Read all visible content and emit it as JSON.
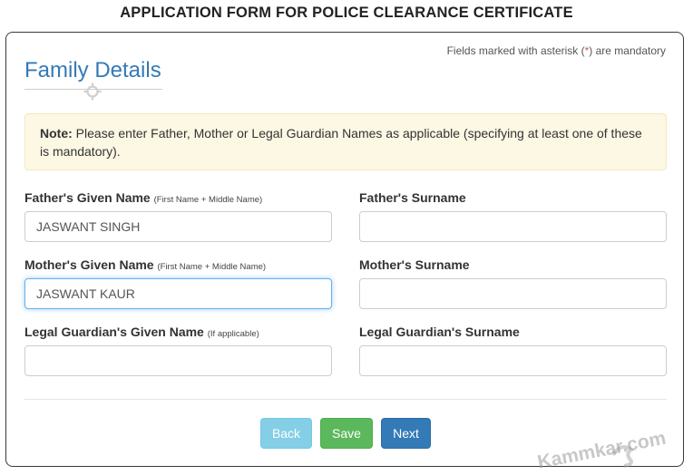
{
  "page": {
    "title": "APPLICATION FORM FOR POLICE CLEARANCE CERTIFICATE"
  },
  "form": {
    "mandatory_prefix": "Fields marked with asterisk (",
    "mandatory_asterisk": "*",
    "mandatory_suffix": ") are mandatory",
    "section_title": "Family Details",
    "note_label": "Note:",
    "note_text": " Please enter Father, Mother or Legal Guardian Names as applicable (specifying at least one of these is mandatory).",
    "fields": {
      "father_given": {
        "label": "Father's Given Name",
        "hint": "(First Name + Middle Name)",
        "value": "JASWANT SINGH"
      },
      "father_surname": {
        "label": "Father's Surname",
        "value": ""
      },
      "mother_given": {
        "label": "Mother's Given Name",
        "hint": "(First Name + Middle Name)",
        "value": "JASWANT KAUR"
      },
      "mother_surname": {
        "label": "Mother's Surname",
        "value": ""
      },
      "guardian_given": {
        "label": "Legal Guardian's Given Name",
        "hint": "(If applicable)",
        "value": ""
      },
      "guardian_surname": {
        "label": "Legal Guardian's Surname",
        "value": ""
      }
    },
    "buttons": {
      "back": "Back",
      "save": "Save",
      "next": "Next"
    }
  },
  "watermark": {
    "text": "Kammkar.com"
  },
  "colors": {
    "accent": "#337ab7",
    "note_bg": "#fcf8e3",
    "back": "#5bc0de",
    "save": "#5cb85c",
    "next": "#337ab7",
    "asterisk": "#d9534f"
  }
}
